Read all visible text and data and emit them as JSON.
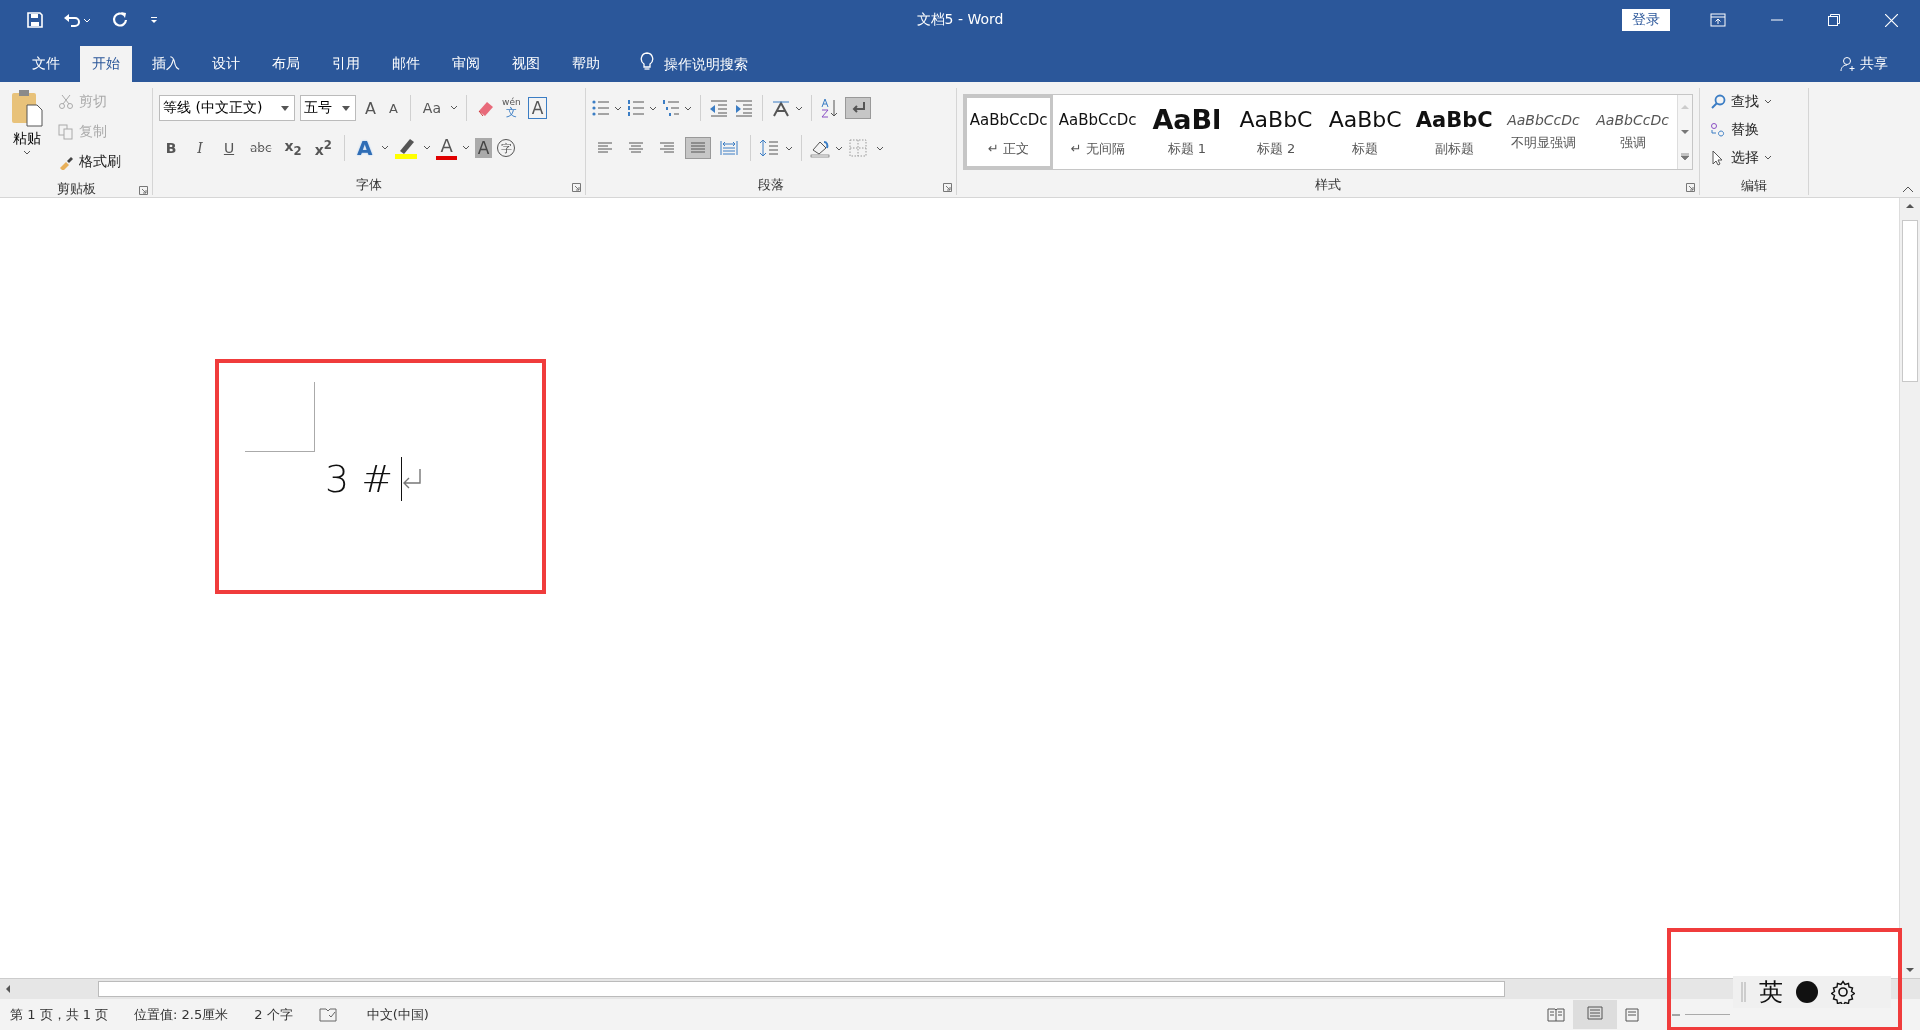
{
  "window": {
    "title": "文档5 - Word",
    "sign_in": "登录"
  },
  "tabs": [
    {
      "label": "文件",
      "selected": false
    },
    {
      "label": "开始",
      "selected": true
    },
    {
      "label": "插入",
      "selected": false
    },
    {
      "label": "设计",
      "selected": false
    },
    {
      "label": "布局",
      "selected": false
    },
    {
      "label": "引用",
      "selected": false
    },
    {
      "label": "邮件",
      "selected": false
    },
    {
      "label": "审阅",
      "selected": false
    },
    {
      "label": "视图",
      "selected": false
    },
    {
      "label": "帮助",
      "selected": false
    }
  ],
  "tell_me": "操作说明搜索",
  "share": "共享",
  "clipboard": {
    "paste": "粘贴",
    "group": "剪贴板",
    "items": [
      {
        "kind": "cut",
        "label": "剪切",
        "disabled": true
      },
      {
        "kind": "copy",
        "label": "复制",
        "disabled": true
      },
      {
        "kind": "painter",
        "label": "格式刷",
        "disabled": false
      }
    ]
  },
  "font": {
    "group": "字体",
    "font_name": "等线 (中文正文)",
    "font_size": "五号",
    "grow": "A",
    "shrink": "A",
    "change_case": "Aa",
    "pinyin_top": "wén",
    "pinyin_bottom": "文",
    "char_border": "A",
    "format_buttons": [
      "B",
      "I",
      "U",
      "abc",
      "x$_{2}$",
      "x$^{2}$"
    ],
    "effects": "A",
    "font_color": "A",
    "shading": "A",
    "enclose": "字"
  },
  "paragraph": {
    "group": "段落",
    "show_marks": {
      "selected": true
    },
    "alignments": [
      {
        "selected": false
      },
      {
        "selected": false
      },
      {
        "selected": false
      },
      {
        "selected": true
      },
      {
        "selected": false
      }
    ]
  },
  "styles": {
    "group": "样式",
    "items": [
      {
        "preview": "AaBbCcDc",
        "label": "↵ 正文",
        "kind": "normal",
        "selected": true
      },
      {
        "preview": "AaBbCcDc",
        "label": "↵ 无间隔",
        "kind": "normal",
        "selected": false
      },
      {
        "preview": "AaBl",
        "label": "标题 1",
        "kind": "heading",
        "selected": false
      },
      {
        "preview": "AaBbC",
        "label": "标题 2",
        "kind": "large",
        "selected": false
      },
      {
        "preview": "AaBbC",
        "label": "标题",
        "kind": "large",
        "selected": false
      },
      {
        "preview": "AaBbC",
        "label": "副标题",
        "kind": "bold",
        "selected": false
      },
      {
        "preview": "AaBbCcDc",
        "label": "不明显强调",
        "kind": "italic",
        "selected": false
      },
      {
        "preview": "AaBbCcDc",
        "label": "强调",
        "kind": "italic",
        "selected": false
      }
    ]
  },
  "editing": {
    "group": "编辑",
    "find": "查找",
    "replace": "替换",
    "select": "选择"
  },
  "document": {
    "text": "3 #"
  },
  "status_bar": [
    "第 1 页，共 1 页",
    "位置值: 2.5厘米",
    "2 个字",
    "中文(中国)"
  ],
  "ime": {
    "mode": "英"
  },
  "annotation_boxes": [
    {
      "color": "#f03c3c"
    },
    {
      "color": "#f03c3c"
    }
  ]
}
